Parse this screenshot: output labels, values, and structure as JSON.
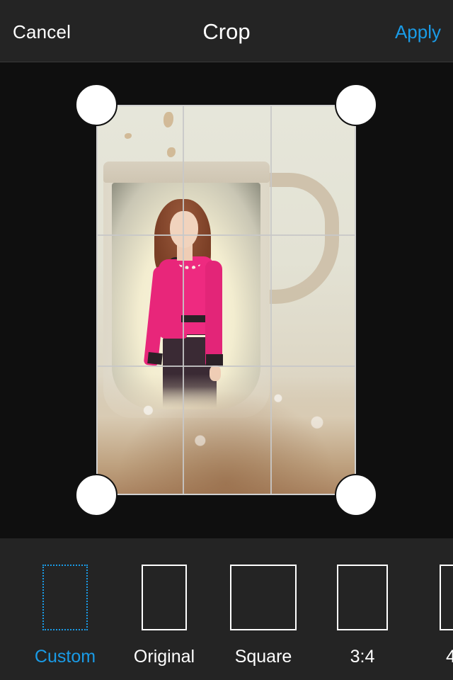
{
  "header": {
    "cancel_label": "Cancel",
    "title": "Crop",
    "apply_label": "Apply"
  },
  "colors": {
    "accent": "#1a9be6",
    "toolbar_bg": "#242424",
    "canvas_bg": "#0f0f0f",
    "text": "#ffffff"
  },
  "canvas": {
    "photo_description": "Woman in pink blazer composited inside a coffee mug with splash",
    "grid": "3x3 rule-of-thirds overlay",
    "handles": [
      "top-left",
      "top-right",
      "bottom-left",
      "bottom-right"
    ]
  },
  "aspect_options": [
    {
      "label": "Custom",
      "icon": "dotted-rectangle-icon",
      "selected": true
    },
    {
      "label": "Original",
      "icon": "portrait-rectangle-icon",
      "selected": false
    },
    {
      "label": "Square",
      "icon": "square-icon",
      "selected": false
    },
    {
      "label": "3:4",
      "icon": "portrait-rectangle-icon",
      "selected": false
    },
    {
      "label": "4",
      "icon": "portrait-rectangle-icon",
      "selected": false
    }
  ]
}
